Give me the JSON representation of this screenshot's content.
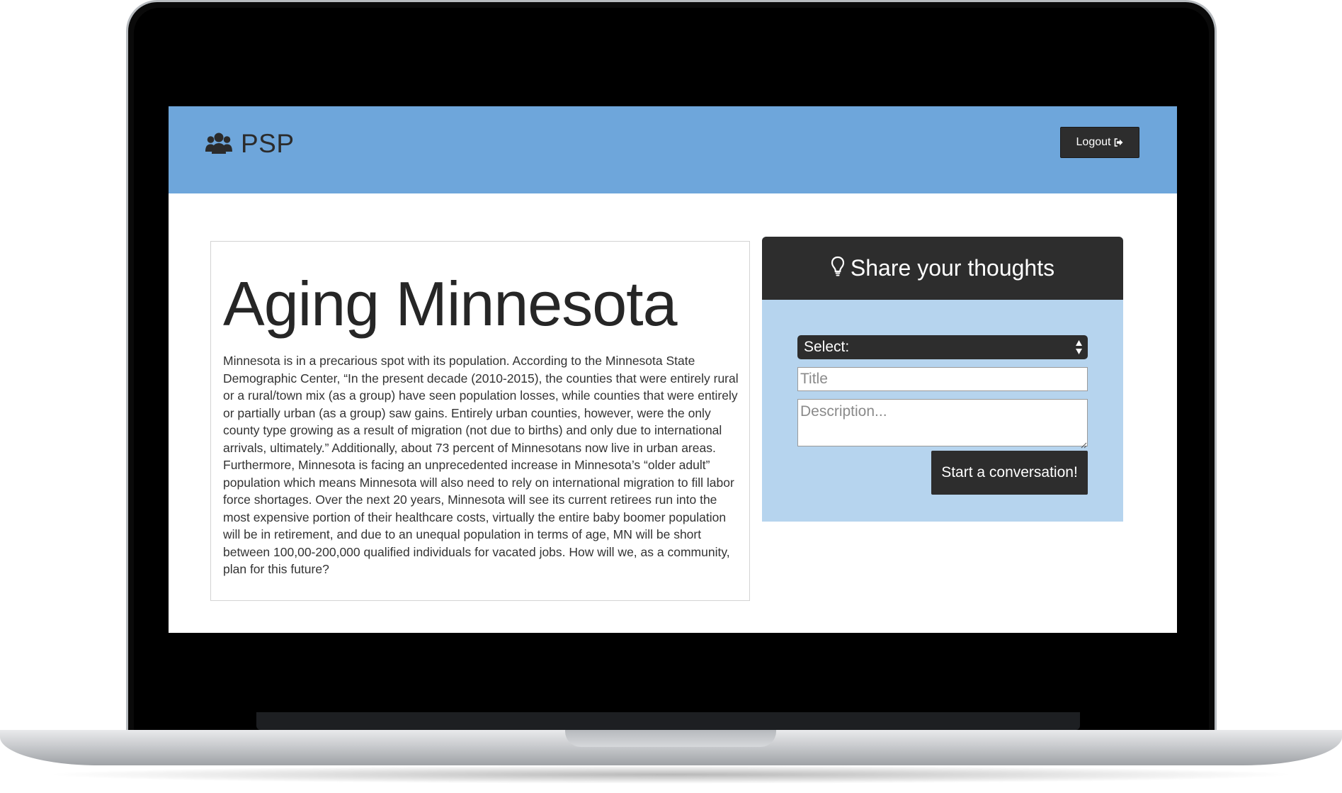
{
  "navbar": {
    "brand": "PSP",
    "brand_icon": "users-icon",
    "logout_label": "Logout",
    "logout_icon": "sign-out-icon",
    "background": "#6ea6db"
  },
  "article": {
    "title": "Aging Minnesota",
    "body": "Minnesota is in a precarious spot with its population. According to the Minnesota State Demographic Center, “In the present decade (2010-2015), the counties that were entirely rural or a rural/town mix (as a group) have seen population losses, while counties that were entirely or partially urban (as a group) saw gains. Entirely urban counties, however, were the only county type growing as a result of migration (not due to births) and only due to international arrivals, ultimately.” Additionally, about 73 percent of Minnesotans now live in urban areas. Furthermore, Minnesota is facing an unprecedented increase in Minnesota’s “older adult” population which means Minnesota will also need to rely on international migration to fill labor force shortages. Over the next 20 years, Minnesota will see its current retirees run into the most expensive portion of their healthcare costs, virtually the entire baby boomer population will be in retirement, and due to an unequal population in terms of age, MN will be short between 100,00-200,000 qualified individuals for vacated jobs. How will we, as a community, plan for this future?"
  },
  "share": {
    "title": "Share your thoughts",
    "header_icon": "lightbulb-icon",
    "select_value": "Select:",
    "title_placeholder": "Title",
    "description_placeholder": "Description...",
    "submit_label": "Start a conversation!",
    "panel_color": "#b6d4ee",
    "dark_color": "#2d2d2d"
  }
}
